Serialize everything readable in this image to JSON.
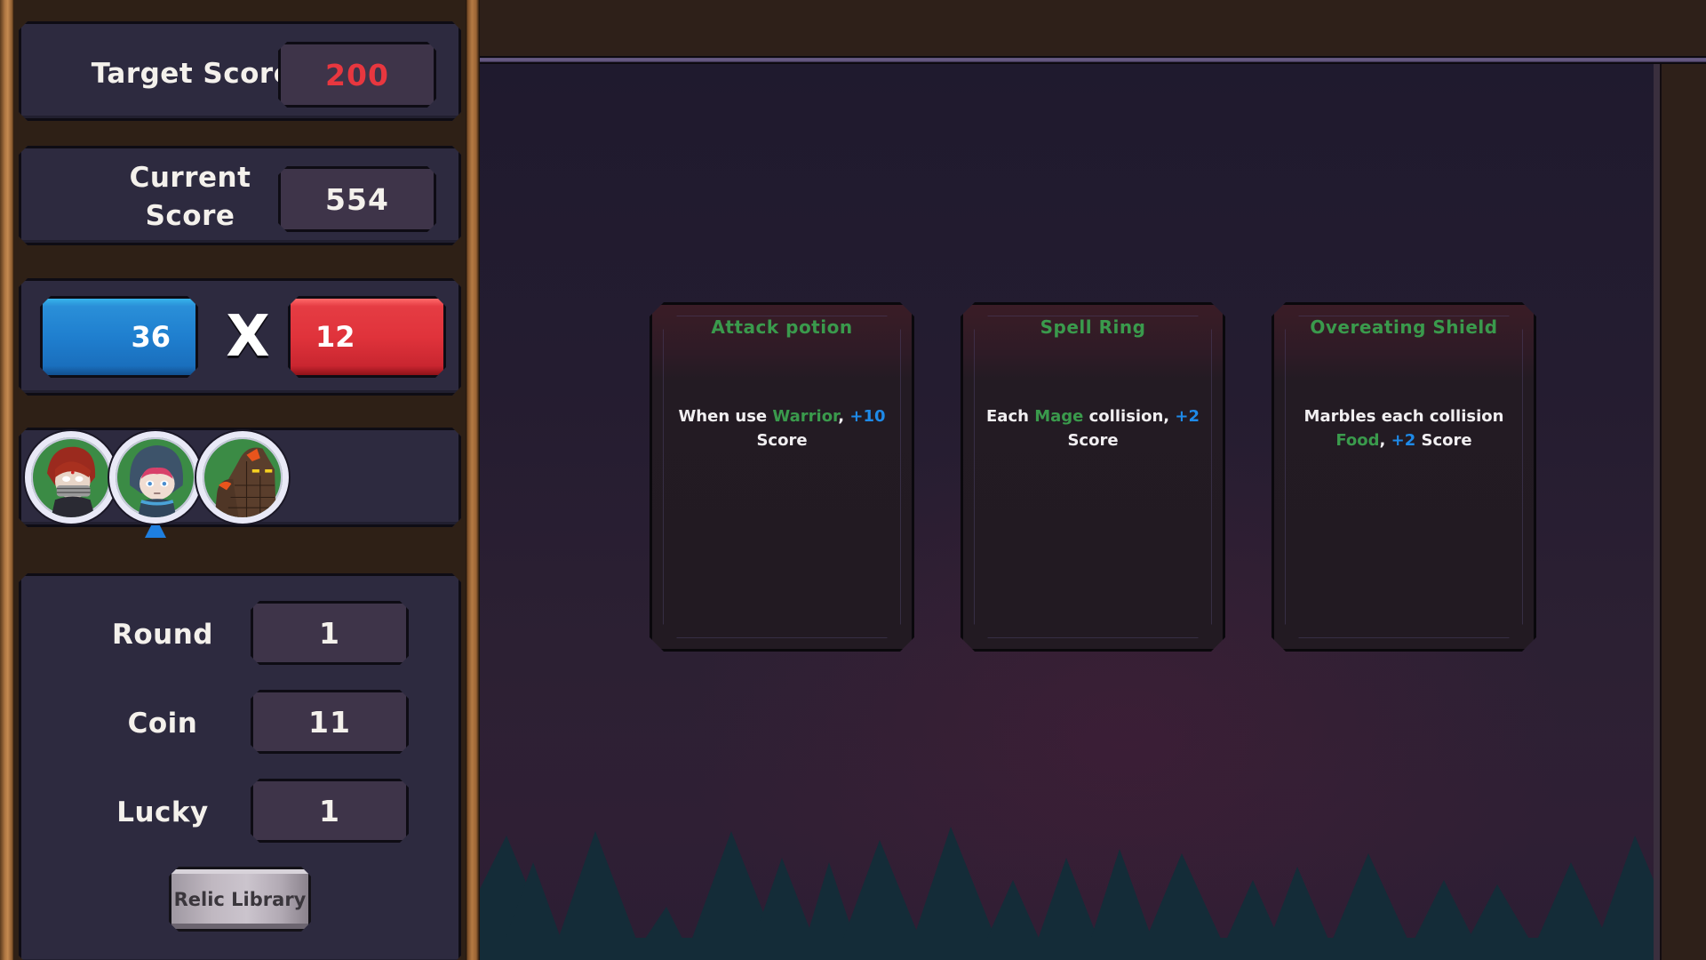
{
  "sidebar": {
    "target_score": {
      "label": "Target Score",
      "value": "200",
      "value_color": "#e8373f"
    },
    "current_score": {
      "label_line1": "Current",
      "label_line2": "Score",
      "value": "554"
    },
    "multiplier": {
      "base": "36",
      "operator": "X",
      "mult": "12",
      "base_color": "#1f7fcf",
      "mult_color": "#e0333b"
    },
    "team": {
      "members": [
        {
          "name": "red-haired-masked-warrior",
          "selected": false
        },
        {
          "name": "hooded-mage",
          "selected": true
        },
        {
          "name": "lava-golem",
          "selected": false
        }
      ]
    },
    "stats": [
      {
        "label": "Round",
        "value": "1"
      },
      {
        "label": "Coin",
        "value": "11"
      },
      {
        "label": "Lucky",
        "value": "1"
      }
    ],
    "relic_library_label": "Relic Library"
  },
  "relics": [
    {
      "title": "Attack potion",
      "desc_parts": [
        {
          "text": "When use ",
          "style": "plain"
        },
        {
          "text": "Warrior",
          "style": "green"
        },
        {
          "text": ", ",
          "style": "plain"
        },
        {
          "text": "+10",
          "style": "blue"
        },
        {
          "text": " Score",
          "style": "plain"
        }
      ]
    },
    {
      "title": "Spell Ring",
      "desc_parts": [
        {
          "text": "Each ",
          "style": "plain"
        },
        {
          "text": "Mage",
          "style": "green"
        },
        {
          "text": " collision, ",
          "style": "plain"
        },
        {
          "text": "+2",
          "style": "blue"
        },
        {
          "text": " Score",
          "style": "plain"
        }
      ]
    },
    {
      "title": "Overeating Shield",
      "desc_parts": [
        {
          "text": "Marbles each collision ",
          "style": "plain"
        },
        {
          "text": "Food",
          "style": "green"
        },
        {
          "text": ", ",
          "style": "plain"
        },
        {
          "text": "+2",
          "style": "blue"
        },
        {
          "text": " Score",
          "style": "plain"
        }
      ]
    }
  ],
  "colors": {
    "highlight_green": "#3a9a4c",
    "highlight_blue": "#1e8ae8",
    "panel": "#2d2a3f",
    "value_box": "#3e3449"
  }
}
